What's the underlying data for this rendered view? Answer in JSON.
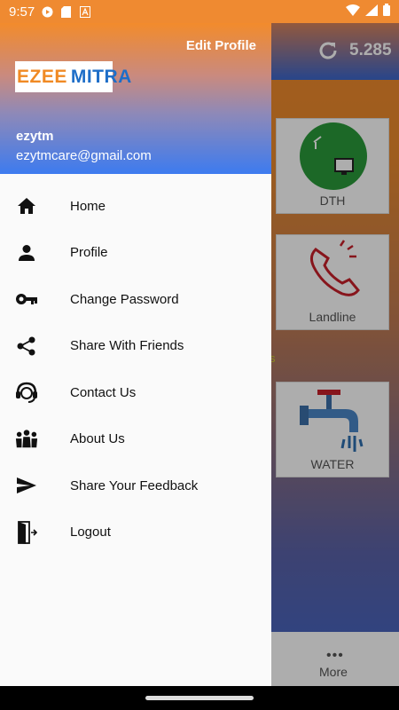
{
  "status_bar": {
    "time": "9:57"
  },
  "background_app": {
    "balance": "5.285",
    "tiles": [
      {
        "label": "DTH"
      },
      {
        "label": "Landline"
      },
      {
        "label": "WATER"
      }
    ],
    "partial_text": "s",
    "bottom_nav": {
      "more_label": "More"
    }
  },
  "drawer": {
    "edit_profile_label": "Edit Profile",
    "logo": {
      "part1": "EZEE",
      "part2": "MITRA"
    },
    "user": {
      "name": "ezytm",
      "email": "ezytmcare@gmail.com"
    },
    "menu": [
      {
        "label": "Home",
        "icon": "home-icon"
      },
      {
        "label": "Profile",
        "icon": "person-icon"
      },
      {
        "label": "Change Password",
        "icon": "key-icon"
      },
      {
        "label": "Share With Friends",
        "icon": "share-icon"
      },
      {
        "label": "Contact Us",
        "icon": "headset-icon"
      },
      {
        "label": "About Us",
        "icon": "group-icon"
      },
      {
        "label": "Share Your Feedback",
        "icon": "send-icon"
      },
      {
        "label": "Logout",
        "icon": "logout-icon"
      }
    ]
  },
  "colors": {
    "status_bar": "#ef8a31",
    "header_gradient_top": "#f28b2c",
    "header_gradient_bottom": "#3d7bef",
    "drawer_bg": "#fafafa"
  }
}
